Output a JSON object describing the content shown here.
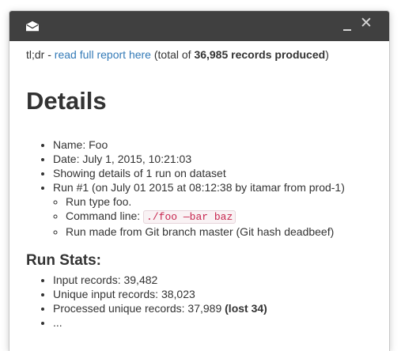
{
  "window": {
    "icon": "envelope-open-icon",
    "minimize_label": "_",
    "close_label": "✕"
  },
  "summary": {
    "prefix": "tl;dr - ",
    "link_text": "read full report here",
    "middle": " (total of ",
    "records_bold": "36,985 records produced",
    "suffix": ")"
  },
  "details": {
    "heading": "Details",
    "items": [
      "Name: Foo",
      "Date: July 1, 2015, 10:21:03",
      "Showing details of 1 run on dataset",
      "Run #1 (on July 01 2015 at 08:12:38 by itamar from prod-1)"
    ],
    "run": {
      "type": "Run type foo.",
      "command_label": "Command line: ",
      "command": "./foo —bar baz",
      "branch": "Run made from Git branch master (Git hash deadbeef)"
    }
  },
  "stats": {
    "heading": "Run Stats:",
    "input": "Input records: 39,482",
    "unique": "Unique input records: 38,023",
    "processed": "Processed unique records: 37,989 ",
    "lost": "(lost 34)",
    "more": "..."
  }
}
